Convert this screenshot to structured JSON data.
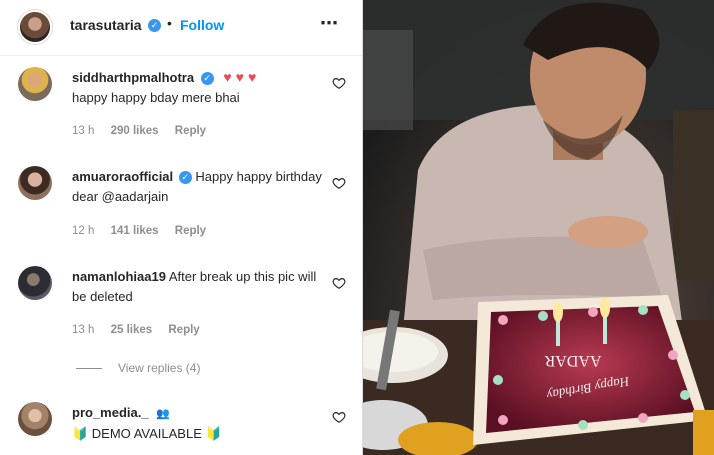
{
  "post": {
    "author": "tarasutaria",
    "follow_label": "Follow",
    "separator": "•",
    "more_icon": "⋯"
  },
  "comments": [
    {
      "username": "siddharthpmalhotra",
      "verified": true,
      "emoji": "♥♥♥",
      "text": "happy happy bday mere bhai",
      "time": "13 h",
      "likes": "290 likes",
      "reply": "Reply"
    },
    {
      "username": "amuaroraofficial",
      "verified": true,
      "text": "Happy happy birthday dear @aadarjain",
      "time": "12 h",
      "likes": "141 likes",
      "reply": "Reply"
    },
    {
      "username": "namanlohiaa19",
      "verified": false,
      "text": "After break up this pic will be deleted",
      "time": "13 h",
      "likes": "25 likes",
      "reply": "Reply"
    },
    {
      "username": "pro_media._",
      "verified": false,
      "badge": "👥",
      "text": "🔰 DEMO AVAILABLE 🔰"
    }
  ],
  "view_replies": "View replies (4)",
  "photo": {
    "cake_text_1": "AADAR",
    "cake_text_2": "Happy Birthday"
  },
  "colors": {
    "accent": "#0095f6",
    "verified": "#3897f0",
    "muted": "#8e8e8e",
    "heart_red": "#ed4956"
  }
}
